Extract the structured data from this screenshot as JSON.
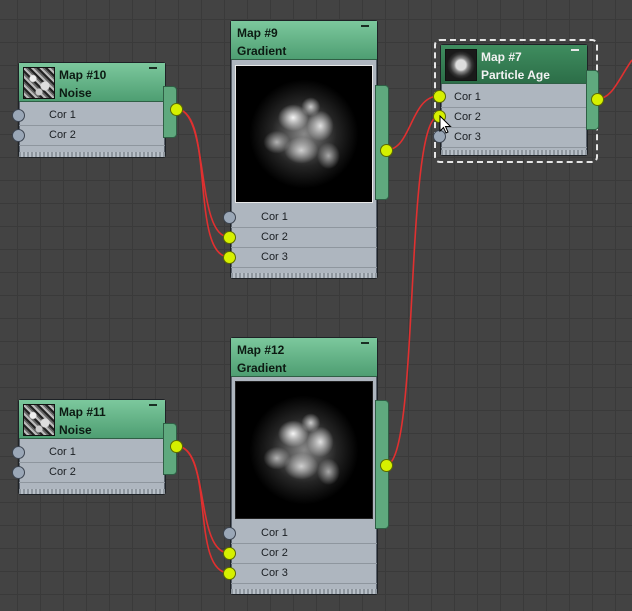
{
  "nodes": {
    "map10": {
      "title": "Map #10",
      "subtitle": "Noise",
      "slots": [
        "Cor 1",
        "Cor 2"
      ]
    },
    "map9": {
      "title": "Map #9",
      "subtitle": "Gradient",
      "slots": [
        "Cor 1",
        "Cor 2",
        "Cor 3"
      ]
    },
    "map7": {
      "title": "Map #7",
      "subtitle": "Particle Age",
      "slots": [
        "Cor 1",
        "Cor 2",
        "Cor 3"
      ]
    },
    "map11": {
      "title": "Map #11",
      "subtitle": "Noise",
      "slots": [
        "Cor 1",
        "Cor 2"
      ]
    },
    "map12": {
      "title": "Map #12",
      "subtitle": "Gradient",
      "slots": [
        "Cor 1",
        "Cor 2",
        "Cor 3"
      ]
    }
  },
  "colors": {
    "background": "#434343",
    "node_header": "#5fa97e",
    "node_body": "#aeb6bf",
    "socket_connected": "#d6f000",
    "socket_empty": "#9aa7b7",
    "wire": "#e03030"
  },
  "icons": {
    "noise_thumb": "noise-thumbnail-icon",
    "particle_thumb": "particle-age-thumbnail-icon",
    "minimize": "minimize-icon",
    "cursor": "mouse-cursor-icon"
  }
}
